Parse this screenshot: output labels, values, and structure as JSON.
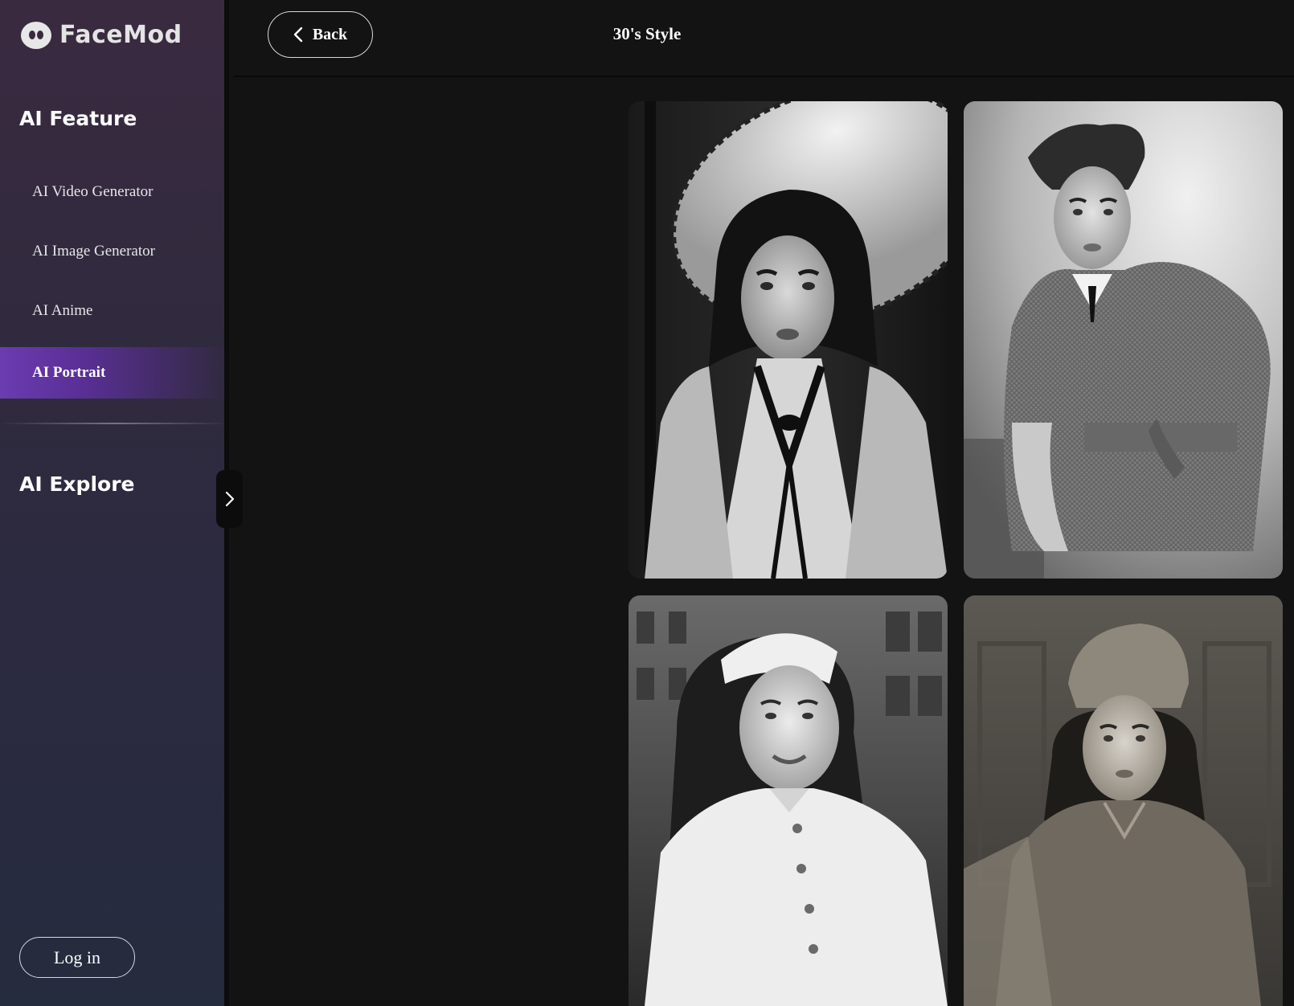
{
  "brand": {
    "name": "FaceMod"
  },
  "sidebar": {
    "feature_title": "AI Feature",
    "items": [
      {
        "label": "AI Video Generator",
        "active": false
      },
      {
        "label": "AI Image Generator",
        "active": false
      },
      {
        "label": "AI Anime",
        "active": false
      },
      {
        "label": "AI Portrait",
        "active": true
      }
    ],
    "explore_title": "AI Explore",
    "login_label": "Log in"
  },
  "header": {
    "back_label": "Back",
    "title": "30's Style"
  },
  "gallery": {
    "images": [
      {
        "subject": "woman in wide-brim lace hat and ruffled dress"
      },
      {
        "subject": "woman in tweed belted jacket"
      },
      {
        "subject": "smiling woman in white blouse and cap"
      },
      {
        "subject": "woman in velvet pillbox hat"
      }
    ]
  },
  "colors": {
    "accent": "#6a3cb0",
    "background": "#131313",
    "sidebar_top": "#3a2a40",
    "sidebar_bottom": "#252c3e"
  },
  "icons": {
    "back": "chevron-left-icon",
    "toggle": "chevron-right-icon",
    "logo": "facemod-logo-icon"
  }
}
